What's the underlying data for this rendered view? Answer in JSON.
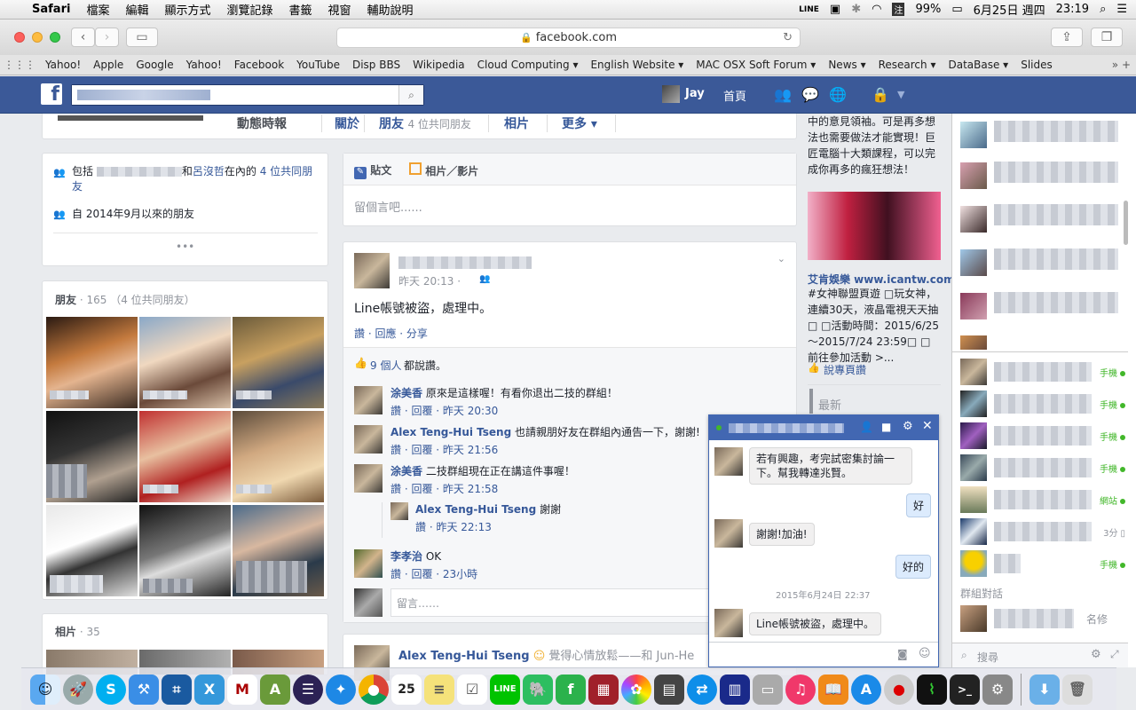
{
  "menubar": {
    "app": "Safari",
    "items": [
      "檔案",
      "編輯",
      "顯示方式",
      "瀏覽記錄",
      "書籤",
      "視窗",
      "輔助說明"
    ],
    "battery": "99%",
    "date": "6月25日 週四",
    "time": "23:19"
  },
  "browser": {
    "url": "facebook.com",
    "bookmarks": [
      "Yahoo!",
      "Apple",
      "Google",
      "Yahoo!",
      "Facebook",
      "YouTube",
      "Disp BBS",
      "Wikipedia",
      "Cloud Computing ▾",
      "English Website ▾",
      "MAC OSX Soft Forum ▾",
      "News ▾",
      "Research ▾",
      "DataBase ▾",
      "Slides"
    ]
  },
  "fbheader": {
    "user": "Jay",
    "home": "首頁"
  },
  "profile_tabs": {
    "timeline": "動態時報",
    "about": "關於",
    "friends": "朋友",
    "friends_mutual": "4 位共同朋友",
    "photos": "相片",
    "more": "更多 ▾"
  },
  "intro": {
    "line1_prefix": "包括",
    "line1_and": "和",
    "line1_name": "呂沒哲",
    "line1_suffix": "在內的",
    "line1_link": "4 位共同朋友",
    "line2": "自 2014年9月以來的朋友",
    "more": "•••"
  },
  "friends_box": {
    "title": "朋友",
    "count": "· 165",
    "mutual": "（4 位共同朋友）"
  },
  "photos_box": {
    "title": "相片",
    "count": "· 35"
  },
  "composer": {
    "post_tab": "貼文",
    "media_tab": "相片／影片",
    "placeholder": "留個言吧......"
  },
  "post": {
    "time": "昨天 20:13 ·",
    "text": "Line帳號被盜，處理中。",
    "actions": "讚 · 回應 · 分享",
    "likes_count": "9 個人",
    "likes_suffix": "都說讚。",
    "comments": [
      {
        "name": "涂美香",
        "text": "原來是這樣喔！有看你退出二技的群組！",
        "meta": "讚 · 回覆 · 昨天 20:30"
      },
      {
        "name": "Alex Teng-Hui Tseng",
        "text": "也請親朋好友在群組內通告一下，謝謝!",
        "meta": "讚 · 回覆 · 昨天 21:56"
      },
      {
        "name": "涂美香",
        "text": "二技群組現在正在講這件事喔！",
        "meta": "讚 · 回覆 · 昨天 21:58"
      }
    ],
    "reply": {
      "name": "Alex Teng-Hui Tseng",
      "text": "謝謝",
      "meta": "讚 · 昨天 22:13"
    },
    "comment4": {
      "name": "李孝治",
      "text": "OK",
      "meta": "讚 · 回覆 · 23小時"
    },
    "comment_placeholder": "留言……"
  },
  "post2": {
    "name": "Alex Teng-Hui Tseng",
    "text": "覺得心情放鬆——和 Jun-He"
  },
  "sidebar": {
    "ad_text_top": "中的意見領袖。可是再多想法也需要做法才能實現！巨匠電腦十大類課程，可以完成你再多的瘋狂想法！",
    "ad_title": "艾肯娛樂 www.icantw.com",
    "ad_body": "#女神聯盟頁遊 □玩女神，連續30天，液晶電視天天抽□ □活動時間：2015/6/25～2015/7/24 23:59□ □ 前往參加活動 >...",
    "ad_like": "說專頁讚",
    "latest": "最新"
  },
  "chat_popup": {
    "msg1": "若有興趣，考完試密集討論一下。幫我轉達兆賢。",
    "reply1": "好",
    "msg2": "謝謝!加油!",
    "reply2": "好的",
    "divider": "2015年6月24日 22:37",
    "msg3": "Line帳號被盜，處理中。"
  },
  "chat_sidebar": {
    "statuses": [
      "手機",
      "手機",
      "手機",
      "手機",
      "網站",
      "3分",
      "手機"
    ],
    "group_label": "群組對話",
    "group_name": "名修",
    "search_placeholder": "搜尋"
  },
  "dock": {
    "calendar_day": "25"
  }
}
